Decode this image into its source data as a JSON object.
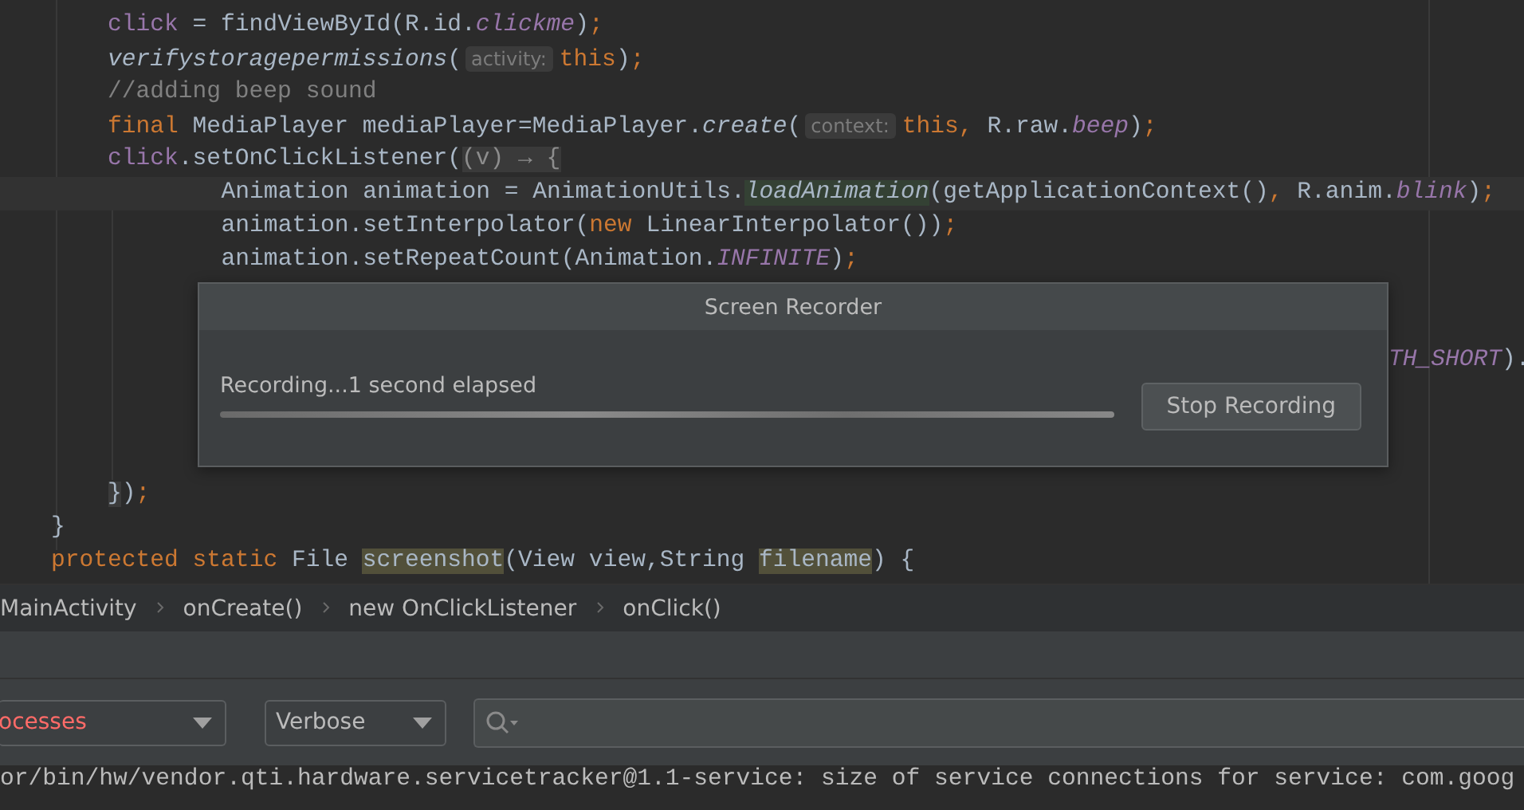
{
  "editor": {
    "lines": [
      {
        "kind": "body",
        "tokens": [
          {
            "kind": "field",
            "text": "click"
          },
          {
            "kind": "plain",
            "text": " = findViewById(R.id."
          },
          {
            "kind": "const",
            "text": "clickme"
          },
          {
            "kind": "plain",
            "text": ")"
          },
          {
            "kind": "punct",
            "text": ";"
          }
        ]
      },
      {
        "kind": "body",
        "tokens": [
          {
            "kind": "italic",
            "text": "verifystoragepermissions"
          },
          {
            "kind": "plain",
            "text": "("
          },
          {
            "kind": "hint",
            "text": "activity:"
          },
          {
            "kind": "keyword",
            "text": "this"
          },
          {
            "kind": "plain",
            "text": ")"
          },
          {
            "kind": "punct",
            "text": ";"
          }
        ]
      },
      {
        "kind": "body",
        "tokens": [
          {
            "kind": "comment",
            "text": "//adding beep sound"
          }
        ]
      },
      {
        "kind": "body",
        "tokens": [
          {
            "kind": "keyword",
            "text": "final "
          },
          {
            "kind": "plain",
            "text": "MediaPlayer mediaPlayer=MediaPlayer."
          },
          {
            "kind": "italic",
            "text": "create"
          },
          {
            "kind": "plain",
            "text": "("
          },
          {
            "kind": "hint",
            "text": "context:"
          },
          {
            "kind": "keyword",
            "text": "this, "
          },
          {
            "kind": "plain",
            "text": "R.raw."
          },
          {
            "kind": "const",
            "text": "beep"
          },
          {
            "kind": "plain",
            "text": ")"
          },
          {
            "kind": "punct",
            "text": ";"
          }
        ]
      },
      {
        "kind": "body",
        "tokens": [
          {
            "kind": "field",
            "text": "click"
          },
          {
            "kind": "plain",
            "text": ".setOnClickListener("
          },
          {
            "kind": "fold",
            "text": "(v) → {"
          }
        ]
      },
      {
        "kind": "nested",
        "current": true,
        "tokens": [
          {
            "kind": "plain",
            "text": "Animation animation = AnimationUtils."
          },
          {
            "kind": "match",
            "text": "loadAnimation"
          },
          {
            "kind": "plain",
            "text": "(getApplicationContext()"
          },
          {
            "kind": "punct",
            "text": ", "
          },
          {
            "kind": "plain",
            "text": "R.anim."
          },
          {
            "kind": "const",
            "text": "blink"
          },
          {
            "kind": "plain",
            "text": ")"
          },
          {
            "kind": "punct",
            "text": ";"
          }
        ]
      },
      {
        "kind": "nested",
        "tokens": [
          {
            "kind": "plain",
            "text": "animation.setInterpolator("
          },
          {
            "kind": "keyword",
            "text": "new "
          },
          {
            "kind": "plain",
            "text": "LinearInterpolator())"
          },
          {
            "kind": "punct",
            "text": ";"
          }
        ]
      },
      {
        "kind": "nested",
        "tokens": [
          {
            "kind": "plain",
            "text": "animation.setRepeatCount(Animation."
          },
          {
            "kind": "const",
            "text": "INFINITE"
          },
          {
            "kind": "plain",
            "text": ")"
          },
          {
            "kind": "punct",
            "text": ";"
          }
        ]
      },
      {
        "kind": "covered"
      },
      {
        "kind": "covered"
      },
      {
        "kind": "tail",
        "tokens": [
          {
            "kind": "const",
            "text": "TH_SHORT"
          },
          {
            "kind": "plain",
            "text": ")."
          }
        ]
      },
      {
        "kind": "covered"
      },
      {
        "kind": "covered"
      },
      {
        "kind": "covered"
      },
      {
        "kind": "body",
        "tokens": [
          {
            "kind": "brace",
            "text": "}"
          },
          {
            "kind": "plain",
            "text": ")"
          },
          {
            "kind": "punct",
            "text": ";"
          }
        ]
      },
      {
        "kind": "top",
        "tokens": [
          {
            "kind": "plain",
            "text": "}"
          }
        ]
      },
      {
        "kind": "top",
        "tokens": [
          {
            "kind": "keyword",
            "text": "protected static "
          },
          {
            "kind": "plain",
            "text": "File "
          },
          {
            "kind": "usage",
            "text": "screenshot"
          },
          {
            "kind": "plain",
            "text": "(View view,String "
          },
          {
            "kind": "usage",
            "text": "filename"
          },
          {
            "kind": "plain",
            "text": ") {"
          }
        ]
      }
    ]
  },
  "dialog": {
    "title": "Screen Recorder",
    "message": "Recording...1 second elapsed",
    "progress": {
      "level": 1
    },
    "button": "Stop Recording"
  },
  "breadcrumbs": [
    "MainActivity",
    "onCreate()",
    "new OnClickListener",
    "onClick()"
  ],
  "logcat": {
    "process_filter": "ocesses",
    "level_filter": "Verbose",
    "log_lines": [
      "or/bin/hw/vendor.qti.hardware.servicetracker@1.1-service: size of service connections for service: com.goog"
    ]
  }
}
